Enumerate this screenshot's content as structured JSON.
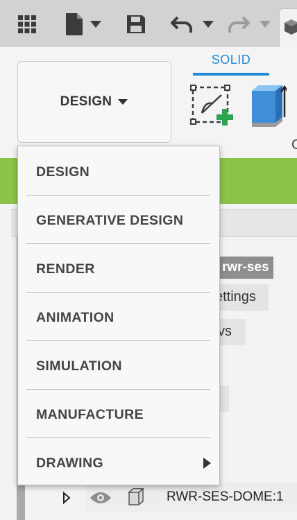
{
  "ribbon": {
    "design_button_label": "DESIGN",
    "active_tab": "SOLID",
    "partial_label": "C"
  },
  "dropdown": {
    "items": [
      {
        "label": "DESIGN",
        "has_submenu": false
      },
      {
        "label": "GENERATIVE DESIGN",
        "has_submenu": false
      },
      {
        "label": "RENDER",
        "has_submenu": false
      },
      {
        "label": "ANIMATION",
        "has_submenu": false
      },
      {
        "label": "SIMULATION",
        "has_submenu": false
      },
      {
        "label": "MANUFACTURE",
        "has_submenu": false
      },
      {
        "label": "DRAWING",
        "has_submenu": true
      }
    ]
  },
  "background": {
    "dark_label": "E rwr-ses",
    "chip_settings": "ettings",
    "chip_views": "vs",
    "tree_item": "RWR-SES-DOME:1"
  },
  "colors": {
    "accent_blue": "#1f8ad6",
    "green_bar": "#8bc34a",
    "plus_green": "#2ea44f"
  }
}
